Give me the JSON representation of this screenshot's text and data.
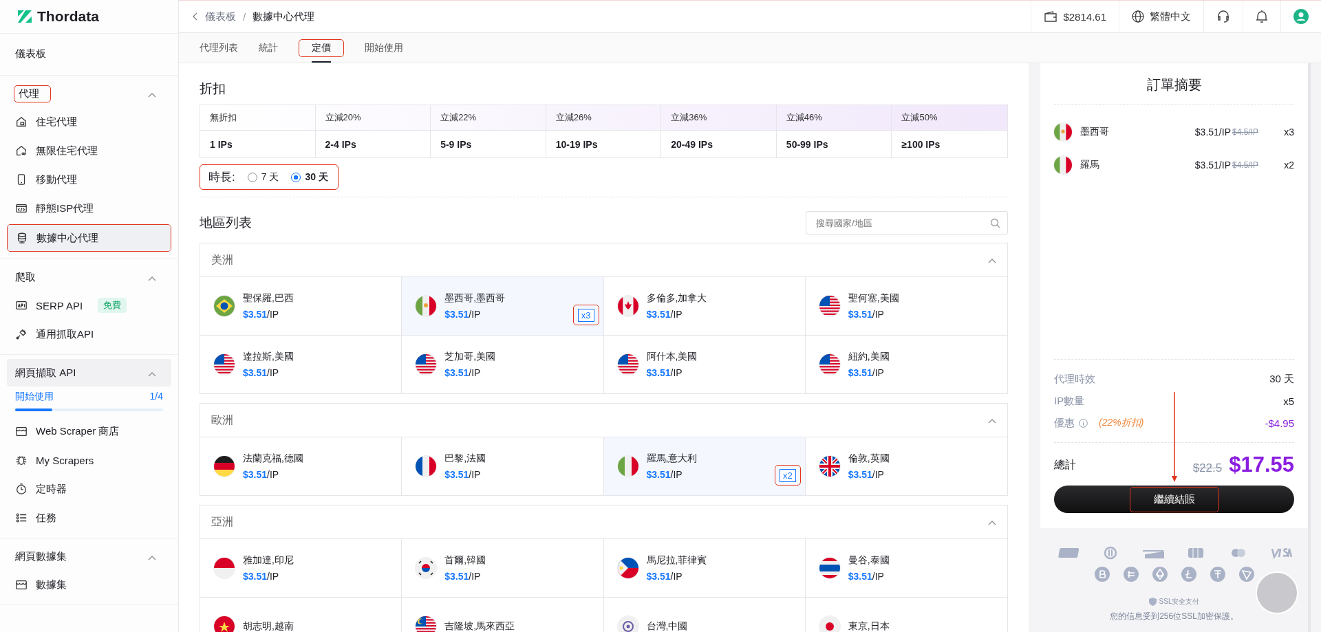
{
  "sidebar": {
    "logo": "Thordata",
    "entries": [
      {
        "kind": "link",
        "label": "儀表板",
        "selected": false
      },
      {
        "kind": "section",
        "title": "代理",
        "expanded": true,
        "shaded": false,
        "annotated": true,
        "children": [
          {
            "kind": "house",
            "label": "住宅代理",
            "selected": false,
            "annotated": false
          },
          {
            "kind": "infinity",
            "label": "無限住宅代理",
            "selected": false,
            "annotated": false
          },
          {
            "kind": "phone",
            "label": "移動代理",
            "selected": false,
            "annotated": false
          },
          {
            "kind": "code",
            "label": "靜態ISP代理",
            "selected": false,
            "annotated": false
          },
          {
            "kind": "database",
            "label": "數據中心代理",
            "selected": true,
            "annotated": true
          }
        ]
      },
      {
        "kind": "section",
        "title": "爬取",
        "expanded": true,
        "shaded": false,
        "annotated": false,
        "children": [
          {
            "kind": "api",
            "label": "SERP API",
            "badge": "免費",
            "selected": false,
            "annotated": false
          },
          {
            "kind": "plug",
            "label": "通用抓取API",
            "selected": false,
            "annotated": false
          }
        ]
      },
      {
        "kind": "section",
        "title": "網頁擷取 API",
        "expanded": true,
        "shaded": true,
        "annotated": false,
        "progress": {
          "label": "開始使用",
          "count": "1/4",
          "level": 0.25
        },
        "children": [
          {
            "kind": "store",
            "label": "Web Scraper 商店",
            "selected": false,
            "annotated": false
          },
          {
            "kind": "bug",
            "label": "My Scrapers",
            "selected": false,
            "annotated": false
          },
          {
            "kind": "timer",
            "label": "定時器",
            "selected": false,
            "annotated": false
          },
          {
            "kind": "list",
            "label": "任務",
            "selected": false,
            "annotated": false
          }
        ]
      },
      {
        "kind": "section",
        "title": "網頁數據集",
        "expanded": true,
        "shaded": false,
        "annotated": false,
        "children": [
          {
            "kind": "store",
            "label": "數據集",
            "selected": false,
            "annotated": false
          }
        ]
      }
    ]
  },
  "topbar": {
    "breadcrumb": [
      "儀表板",
      "數據中心代理"
    ],
    "separator": "/",
    "balance": "$2814.61",
    "language": "繁體中文"
  },
  "tabs": [
    {
      "label": "代理列表",
      "selected": false,
      "annotated": false
    },
    {
      "label": "統計",
      "selected": false,
      "annotated": false
    },
    {
      "label": "定價",
      "selected": true,
      "annotated": true
    },
    {
      "label": "開始使用",
      "selected": false,
      "annotated": false
    }
  ],
  "discount": {
    "title": "折扣",
    "columns": [
      {
        "label": "無折扣",
        "range": "1 IPs"
      },
      {
        "label": "立減20%",
        "range": "2-4 IPs"
      },
      {
        "label": "立減22%",
        "range": "5-9 IPs"
      },
      {
        "label": "立減26%",
        "range": "10-19 IPs"
      },
      {
        "label": "立減36%",
        "range": "20-49 IPs"
      },
      {
        "label": "立減46%",
        "range": "50-99 IPs"
      },
      {
        "label": "立減50%",
        "range": "≥100 IPs"
      }
    ]
  },
  "duration": {
    "label": "時長:",
    "annotated": true,
    "options": [
      {
        "label": "7 天",
        "selected": false
      },
      {
        "label": "30 天",
        "selected": true
      }
    ]
  },
  "regions": {
    "title": "地區列表",
    "search": {
      "placeholder": "搜尋國家/地區"
    },
    "groups": [
      {
        "name": "美洲",
        "expanded": true,
        "items": [
          {
            "kind": "br",
            "name": "聖保羅,巴西",
            "price": "$3.51",
            "unit": "/IP",
            "selected": false
          },
          {
            "kind": "mx",
            "name": "墨西哥,墨西哥",
            "price": "$3.51",
            "unit": "/IP",
            "selected": true,
            "quantity": "x3",
            "annotated": true
          },
          {
            "kind": "ca",
            "name": "多倫多,加拿大",
            "price": "$3.51",
            "unit": "/IP",
            "selected": false
          },
          {
            "kind": "us",
            "name": "聖何塞,美國",
            "price": "$3.51",
            "unit": "/IP",
            "selected": false
          },
          {
            "kind": "us",
            "name": "達拉斯,美國",
            "price": "$3.51",
            "unit": "/IP",
            "selected": false
          },
          {
            "kind": "us",
            "name": "芝加哥,美國",
            "price": "$3.51",
            "unit": "/IP",
            "selected": false
          },
          {
            "kind": "us",
            "name": "阿什本,美國",
            "price": "$3.51",
            "unit": "/IP",
            "selected": false
          },
          {
            "kind": "us",
            "name": "紐約,美國",
            "price": "$3.51",
            "unit": "/IP",
            "selected": false
          }
        ]
      },
      {
        "name": "歐洲",
        "expanded": true,
        "items": [
          {
            "kind": "de",
            "name": "法蘭克福,德國",
            "price": "$3.51",
            "unit": "/IP",
            "selected": false
          },
          {
            "kind": "fr",
            "name": "巴黎,法國",
            "price": "$3.51",
            "unit": "/IP",
            "selected": false
          },
          {
            "kind": "it",
            "name": "羅馬,意大利",
            "price": "$3.51",
            "unit": "/IP",
            "selected": true,
            "quantity": "x2",
            "annotated": true
          },
          {
            "kind": "gb",
            "name": "倫敦,英國",
            "price": "$3.51",
            "unit": "/IP",
            "selected": false
          }
        ]
      },
      {
        "name": "亞洲",
        "expanded": true,
        "items": [
          {
            "kind": "id",
            "name": "雅加達,印尼",
            "price": "$3.51",
            "unit": "/IP",
            "selected": false
          },
          {
            "kind": "kr",
            "name": "首爾,韓國",
            "price": "$3.51",
            "unit": "/IP",
            "selected": false
          },
          {
            "kind": "ph",
            "name": "馬尼拉,菲律賓",
            "price": "$3.51",
            "unit": "/IP",
            "selected": false
          },
          {
            "kind": "th",
            "name": "曼谷,泰國",
            "price": "$3.51",
            "unit": "/IP",
            "selected": false
          },
          {
            "kind": "vn",
            "name": "胡志明,越南",
            "selected": false
          },
          {
            "kind": "my",
            "name": "吉隆坡,馬來西亞",
            "selected": false
          },
          {
            "kind": "tw",
            "name": "台灣,中國",
            "selected": false
          },
          {
            "kind": "jp",
            "name": "東京,日本",
            "selected": false
          }
        ]
      }
    ]
  },
  "summary": {
    "title": "訂單摘要",
    "items": [
      {
        "kind": "mx",
        "name": "墨西哥",
        "price": "$3.51/IP",
        "original": "$4.5/IP",
        "quantity": "x3"
      },
      {
        "kind": "it",
        "name": "羅馬",
        "price": "$3.51/IP",
        "original": "$4.5/IP",
        "quantity": "x2"
      }
    ],
    "rows": [
      {
        "kind": "plain",
        "label": "代理時效",
        "value": "30 天"
      },
      {
        "kind": "plain",
        "label": "IP數量",
        "value": "x5"
      },
      {
        "kind": "discount",
        "label": "優惠",
        "note": "(22%折扣)",
        "value": "-$4.95"
      }
    ],
    "total_label": "總計",
    "total_original": "$22.5",
    "total": "$17.55",
    "checkout": {
      "label": "繼續結賬",
      "annotated": true,
      "arrow": true
    },
    "ssl_label": "SSL安全支付",
    "ssl_note": "您的信息受到256位SSL加密保護。"
  }
}
